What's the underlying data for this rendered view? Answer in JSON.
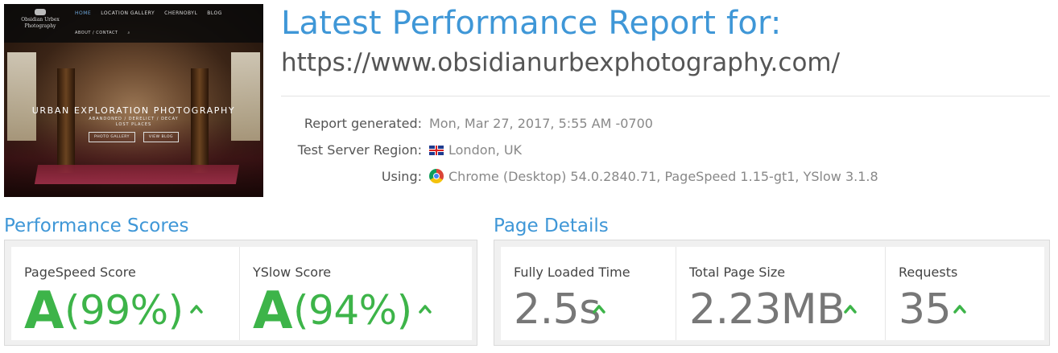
{
  "thumbnail": {
    "logo_text": "Obsidian Urbex Photography",
    "nav": [
      "HOME",
      "LOCATION GALLERY",
      "CHERNOBYL",
      "BLOG"
    ],
    "nav2": [
      "ABOUT / CONTACT",
      "⌕"
    ],
    "hero_title": "URBAN EXPLORATION PHOTOGRAPHY",
    "hero_sub": "ABANDONED / DERELICT / DECAY",
    "hero_sub2": "LOST PLACES",
    "buttons": [
      "PHOTO GALLERY",
      "VIEW BLOG"
    ]
  },
  "header": {
    "title": "Latest Performance Report for:",
    "url": "https://www.obsidianurbexphotography.com/"
  },
  "meta": {
    "generated_label": "Report generated:",
    "generated_value": "Mon, Mar 27, 2017, 5:55 AM -0700",
    "region_label": "Test Server Region:",
    "region_value": "London, UK",
    "region_icon": "uk-flag-icon",
    "using_label": "Using:",
    "using_value": "Chrome (Desktop) 54.0.2840.71, PageSpeed 1.15-gt1, YSlow 3.1.8",
    "using_icon": "chrome-icon"
  },
  "performance": {
    "title": "Performance Scores",
    "pagespeed": {
      "label": "PageSpeed Score",
      "grade": "A",
      "percent": "(99%)"
    },
    "yslow": {
      "label": "YSlow Score",
      "grade": "A",
      "percent": "(94%)"
    }
  },
  "details": {
    "title": "Page Details",
    "load_time": {
      "label": "Fully Loaded Time",
      "value": "2.5s"
    },
    "page_size": {
      "label": "Total Page Size",
      "value": "2.23MB"
    },
    "requests": {
      "label": "Requests",
      "value": "35"
    }
  },
  "colors": {
    "accent_blue": "#3f97d7",
    "grade_green": "#3db449",
    "value_gray": "#777777"
  }
}
